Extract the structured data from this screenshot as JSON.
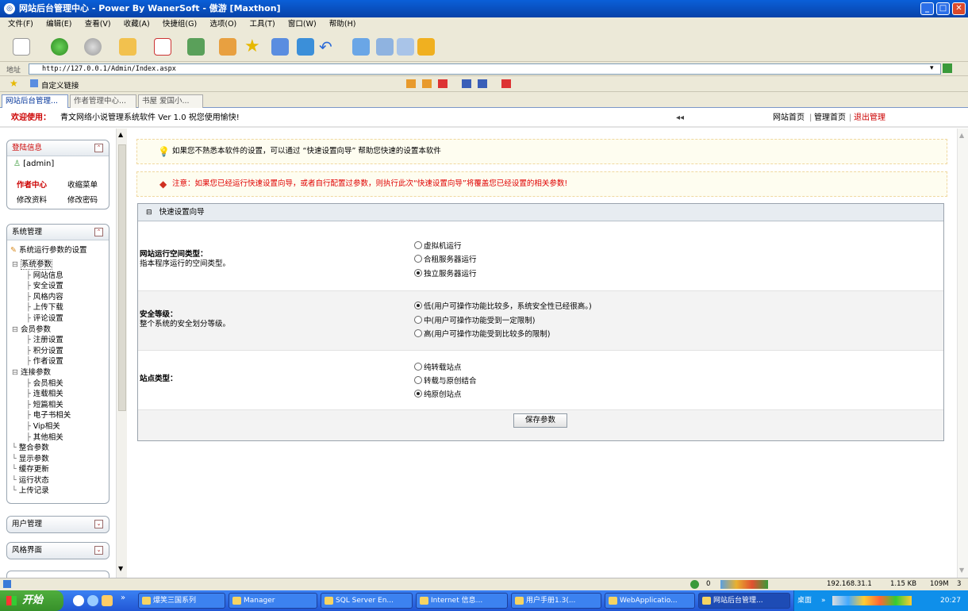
{
  "window": {
    "title": "网站后台管理中心 - Power By WanerSoft - 傲游 [Maxthon]"
  },
  "menu": [
    "文件(F)",
    "编辑(E)",
    "查看(V)",
    "收藏(A)",
    "快捷组(G)",
    "选项(O)",
    "工具(T)",
    "窗口(W)",
    "帮助(H)"
  ],
  "address": {
    "label": "地址",
    "url": "http://127.0.0.1/Admin/Index.aspx"
  },
  "favbar": {
    "label": "自定义链接"
  },
  "tabs": [
    "网站后台管理...",
    "作者管理中心...",
    "书屋 爱国小..."
  ],
  "siteHeader": {
    "welcome": "欢迎使用：",
    "product": "青文网络小说管理系统软件 Ver 1.0  祝您使用愉快!",
    "arrows": "◂◂",
    "links": [
      "网站首页",
      "管理首页",
      "退出管理"
    ]
  },
  "sidebar": {
    "login": {
      "title": "登陆信息",
      "user": "[admin]",
      "links": [
        "作者中心",
        "收缩菜单",
        "修改资料",
        "修改密码"
      ]
    },
    "system": {
      "title": "系统管理",
      "subtitle": "系统运行参数的设置",
      "tree": [
        {
          "label": "系统参数",
          "level": 0,
          "expanded": true
        },
        {
          "label": "网站信息",
          "level": 1
        },
        {
          "label": "安全设置",
          "level": 1
        },
        {
          "label": "风格内容",
          "level": 1
        },
        {
          "label": "上传下载",
          "level": 1
        },
        {
          "label": "评论设置",
          "level": 1
        },
        {
          "label": "会员参数",
          "level": 0,
          "expanded": true
        },
        {
          "label": "注册设置",
          "level": 1
        },
        {
          "label": "积分设置",
          "level": 1
        },
        {
          "label": "作者设置",
          "level": 1
        },
        {
          "label": "连接参数",
          "level": 0,
          "expanded": true
        },
        {
          "label": "会员相关",
          "level": 1
        },
        {
          "label": "连载相关",
          "level": 1
        },
        {
          "label": "短篇相关",
          "level": 1
        },
        {
          "label": "电子书相关",
          "level": 1
        },
        {
          "label": "Vip相关",
          "level": 1
        },
        {
          "label": "其他相关",
          "level": 1
        },
        {
          "label": "整合参数",
          "level": 0
        },
        {
          "label": "显示参数",
          "level": 0
        },
        {
          "label": "缓存更新",
          "level": 0
        },
        {
          "label": "运行状态",
          "level": 0
        },
        {
          "label": "上传记录",
          "level": 0
        }
      ]
    },
    "userMgmt": {
      "title": "用户管理"
    },
    "styleUi": {
      "title": "风格界面"
    }
  },
  "main": {
    "tip": "如果您不熟悉本软件的设置，可以通过 “快速设置向导” 帮助您快速的设置本软件",
    "warning": "注意：如果您已经运行快速设置向导，或者自行配置过参数，则执行此次“快速设置向导”将覆盖您已经设置的相关参数!",
    "wizard": {
      "title": "快速设置向导",
      "sections": [
        {
          "title": "网站运行空间类型：",
          "desc": "指本程序运行的空间类型。",
          "options": [
            "虚拟机运行",
            "合租服务器运行",
            "独立服务器运行"
          ],
          "selected": 2
        },
        {
          "title": "安全等级：",
          "desc": "整个系统的安全划分等级。",
          "options": [
            "低(用户可操作功能比较多，系统安全性已经很高。)",
            "中(用户可操作功能受到一定限制)",
            "高(用户可操作功能受到比较多的限制)"
          ],
          "selected": 0
        },
        {
          "title": "站点类型：",
          "desc": "",
          "options": [
            "纯转载站点",
            "转载与原创结合",
            "纯原创站点"
          ],
          "selected": 2
        }
      ],
      "saveLabel": "保存参数"
    }
  },
  "statusbar": {
    "zero": "0",
    "ip": "192.168.31.1",
    "rate": "1.15 KB",
    "mem": "109M",
    "n": "3"
  },
  "taskbar": {
    "start": "开始",
    "items": [
      "爆笑三国系列",
      "Manager",
      "SQL Server En...",
      "Internet 信息...",
      "用户手册1.3(...",
      "WebApplicatio...",
      "网站后台管理..."
    ],
    "desktop": "桌面",
    "clock": "20:27"
  }
}
